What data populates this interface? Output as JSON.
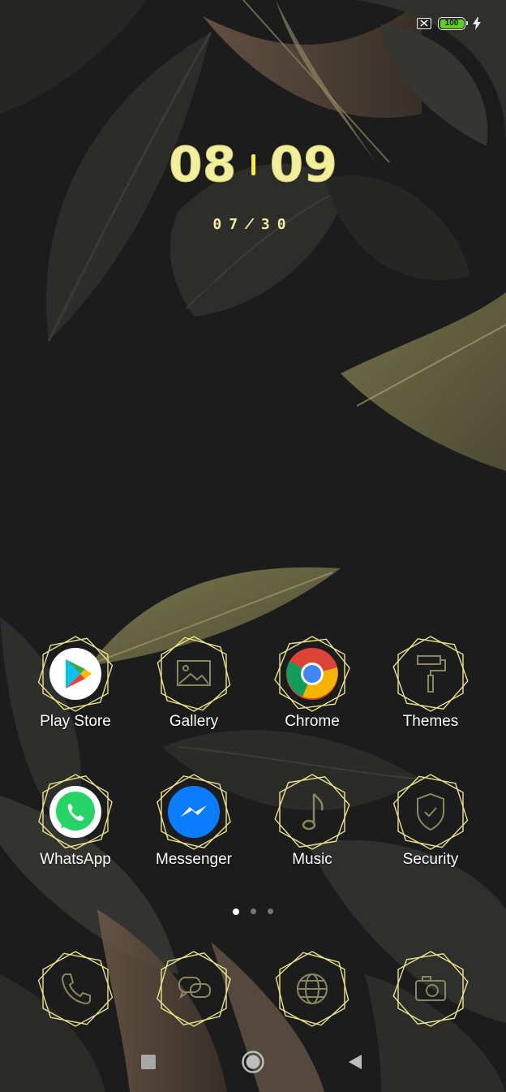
{
  "status_bar": {
    "battery_level": "100",
    "battery_color": "#5fd11c",
    "sim_icon": "no-sim-icon",
    "charging_icon": "bolt-icon"
  },
  "clock": {
    "hour": "08",
    "minute": "09",
    "accent_color": "#f1ef9c"
  },
  "date": {
    "month": "07",
    "day": "30"
  },
  "apps": [
    {
      "label": "Play Store",
      "icon": "play-store-icon"
    },
    {
      "label": "Gallery",
      "icon": "gallery-icon"
    },
    {
      "label": "Chrome",
      "icon": "chrome-icon"
    },
    {
      "label": "Themes",
      "icon": "paint-roller-icon"
    },
    {
      "label": "WhatsApp",
      "icon": "whatsapp-icon"
    },
    {
      "label": "Messenger",
      "icon": "messenger-icon"
    },
    {
      "label": "Music",
      "icon": "music-note-icon"
    },
    {
      "label": "Security",
      "icon": "shield-check-icon"
    }
  ],
  "dock": [
    {
      "icon": "phone-icon"
    },
    {
      "icon": "messages-icon"
    },
    {
      "icon": "browser-globe-icon"
    },
    {
      "icon": "camera-icon"
    }
  ],
  "pages": {
    "count": 3,
    "active": 0
  },
  "navigation": [
    "recents-button",
    "home-button",
    "back-button"
  ],
  "theme": {
    "frame_color": "#e9e28a",
    "background": "#1c1c1c"
  }
}
